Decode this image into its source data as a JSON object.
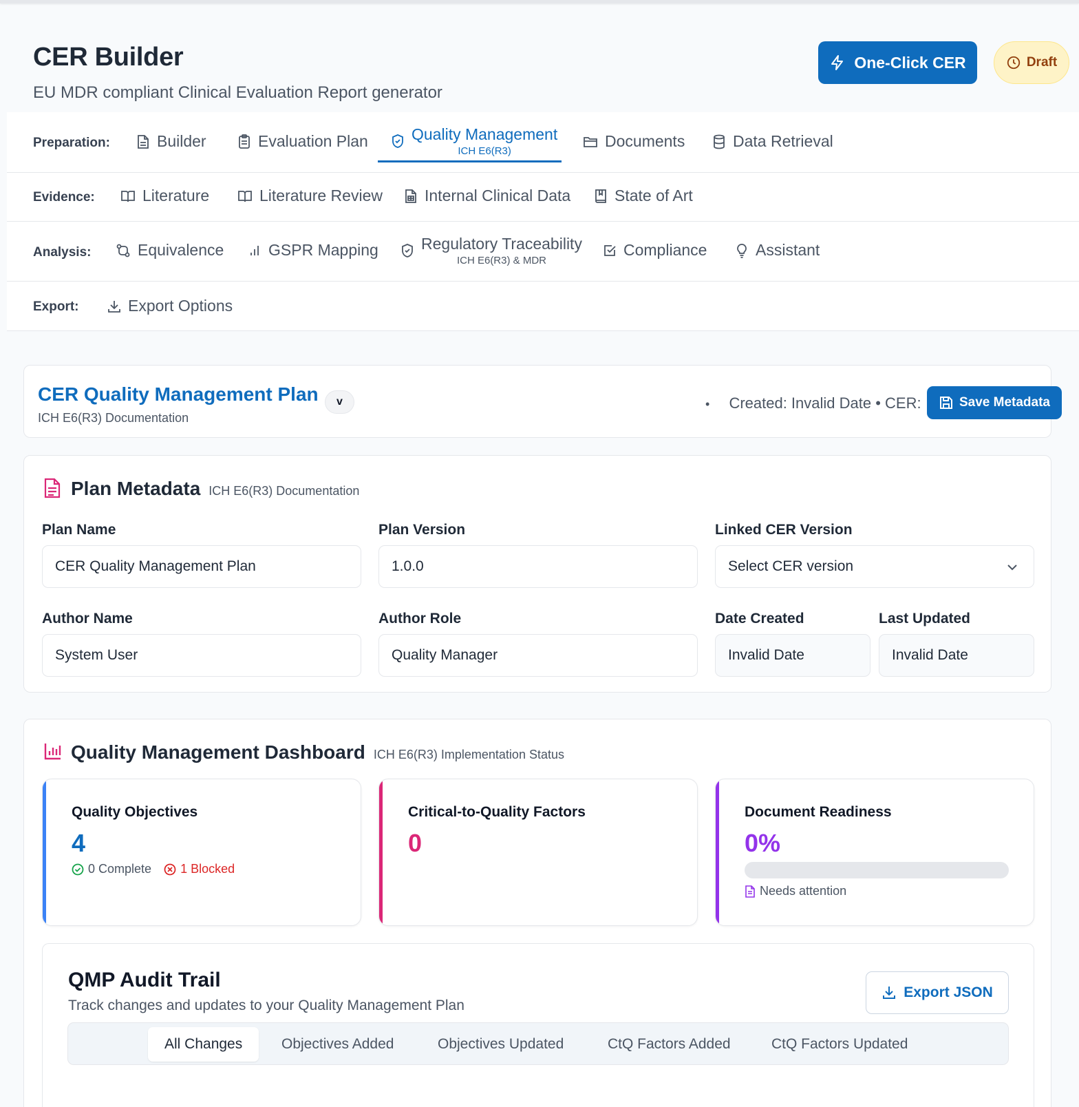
{
  "app": {
    "title": "CER Builder",
    "subtitle": "EU MDR compliant Clinical Evaluation Report generator",
    "one_click_label": "One-Click CER",
    "status_label": "Draft"
  },
  "nav": {
    "preparation": {
      "label": "Preparation:",
      "items": [
        {
          "label": "Builder",
          "icon": "document-icon"
        },
        {
          "label": "Evaluation Plan",
          "icon": "clipboard-icon"
        },
        {
          "label": "Quality Management",
          "sub": "ICH E6(R3)",
          "icon": "shield-check-icon",
          "active": true
        },
        {
          "label": "Documents",
          "icon": "folder-icon"
        },
        {
          "label": "Data Retrieval",
          "icon": "database-icon"
        }
      ]
    },
    "evidence": {
      "label": "Evidence:",
      "items": [
        {
          "label": "Literature",
          "icon": "book-open-icon"
        },
        {
          "label": "Literature Review",
          "icon": "book-open-icon"
        },
        {
          "label": "Internal Clinical Data",
          "icon": "file-spreadsheet-icon"
        },
        {
          "label": "State of Art",
          "icon": "bookmark-book-icon"
        }
      ]
    },
    "analysis": {
      "label": "Analysis:",
      "items": [
        {
          "label": "Equivalence",
          "icon": "git-compare-icon"
        },
        {
          "label": "GSPR Mapping",
          "icon": "bar-chart-icon"
        },
        {
          "label": "Regulatory Traceability",
          "sub": "ICH E6(R3) & MDR",
          "icon": "shield-icon"
        },
        {
          "label": "Compliance",
          "icon": "check-square-icon"
        },
        {
          "label": "Assistant",
          "icon": "lightbulb-icon"
        }
      ]
    },
    "export": {
      "label": "Export:",
      "items": [
        {
          "label": "Export Options",
          "icon": "download-icon"
        }
      ]
    }
  },
  "qmp": {
    "title": "CER Quality Management Plan",
    "subtitle": "ICH E6(R3) Documentation",
    "version_badge": "v",
    "bullet": "•",
    "created_text": "Created: Invalid Date • CER:",
    "save_label": "Save Metadata"
  },
  "metadata": {
    "title": "Plan Metadata",
    "subtitle": "ICH E6(R3) Documentation",
    "fields": {
      "plan_name": {
        "label": "Plan Name",
        "value": "CER Quality Management Plan"
      },
      "plan_version": {
        "label": "Plan Version",
        "value": "1.0.0"
      },
      "linked_cer": {
        "label": "Linked CER Version",
        "value": "Select CER version"
      },
      "author_name": {
        "label": "Author Name",
        "value": "System User"
      },
      "author_role": {
        "label": "Author Role",
        "value": "Quality Manager"
      },
      "date_created": {
        "label": "Date Created",
        "value": "Invalid Date"
      },
      "last_updated": {
        "label": "Last Updated",
        "value": "Invalid Date"
      }
    }
  },
  "dashboard": {
    "title": "Quality Management Dashboard",
    "subtitle": "ICH E6(R3) Implementation Status",
    "objectives": {
      "label": "Quality Objectives",
      "value": "4",
      "complete": "0 Complete",
      "blocked": "1 Blocked",
      "color": "#0f6cbd"
    },
    "ctq": {
      "label": "Critical-to-Quality Factors",
      "value": "0",
      "color": "#db2777"
    },
    "readiness": {
      "label": "Document Readiness",
      "value": "0%",
      "progress": 0,
      "status": "Needs attention",
      "color": "#9333ea"
    }
  },
  "audit": {
    "title": "QMP Audit Trail",
    "subtitle": "Track changes and updates to your Quality Management Plan",
    "export_label": "Export JSON",
    "tabs": [
      "All Changes",
      "Objectives Added",
      "Objectives Updated",
      "CtQ Factors Added",
      "CtQ Factors Updated"
    ]
  },
  "colors": {
    "primary": "#0f6cbd",
    "pink": "#db2777",
    "purple": "#9333ea",
    "success": "#16a34a",
    "danger": "#dc2626"
  }
}
